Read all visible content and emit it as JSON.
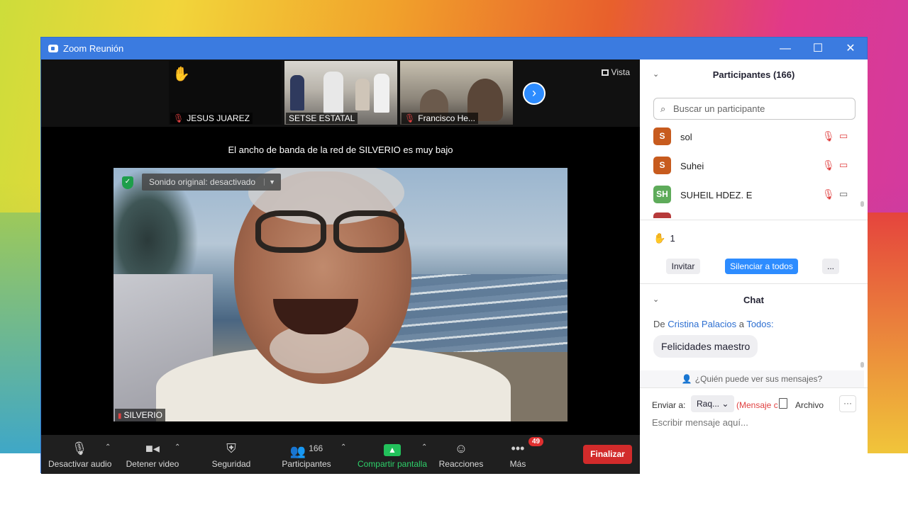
{
  "window": {
    "title": "Zoom Reunión",
    "controls": [
      "—",
      "☐",
      "✕"
    ]
  },
  "thumbnails": [
    {
      "name": "JESUS JUAREZ",
      "muted": true,
      "hand": true
    },
    {
      "name": "SETSE ESTATAL",
      "muted": false,
      "hand": false
    },
    {
      "name": "Francisco He...",
      "muted": true,
      "hand": false
    }
  ],
  "view_label": "Vista",
  "bandwidth_notice": "El ancho de banda de la red de SILVERIO es muy bajo",
  "original_sound": "Sonido original: desactivado",
  "speaker_name": "SILVERIO",
  "toolbar": {
    "mute": "Desactivar audio",
    "video": "Detener video",
    "security": "Seguridad",
    "participants": "Participantes",
    "participants_count": "166",
    "share": "Compartir pantalla",
    "reactions": "Reacciones",
    "more": "Más",
    "more_badge": "49",
    "end": "Finalizar"
  },
  "participants_panel": {
    "title": "Participantes (166)",
    "search_placeholder": "Buscar un participante",
    "list": [
      {
        "initials": "S",
        "name": "sol",
        "color": "#c75b1e",
        "video_off": true
      },
      {
        "initials": "S",
        "name": "Suhei",
        "color": "#c75b1e",
        "video_off": true
      },
      {
        "initials": "SH",
        "name": "SUHEIL HDEZ. E",
        "color": "#5eab5a",
        "video_off": false
      },
      {
        "initials": "",
        "name": "",
        "color": "#b63a3a",
        "video_off": true
      }
    ],
    "raised_hands": "1",
    "invite": "Invitar",
    "mute_all": "Silenciar a todos",
    "more": "..."
  },
  "chat": {
    "title": "Chat",
    "from_prefix": "De",
    "from_name": "Cristina Palacios",
    "to_word": "a",
    "to_name": "Todos:",
    "message": "Felicidades maestro",
    "who_can_see": "¿Quién puede ver sus mensajes?",
    "send_to_label": "Enviar a:",
    "recipient": "Raq...",
    "private_note": "(Mensaje c",
    "file_label": "Archivo",
    "input_placeholder": "Escribir mensaje aquí..."
  }
}
